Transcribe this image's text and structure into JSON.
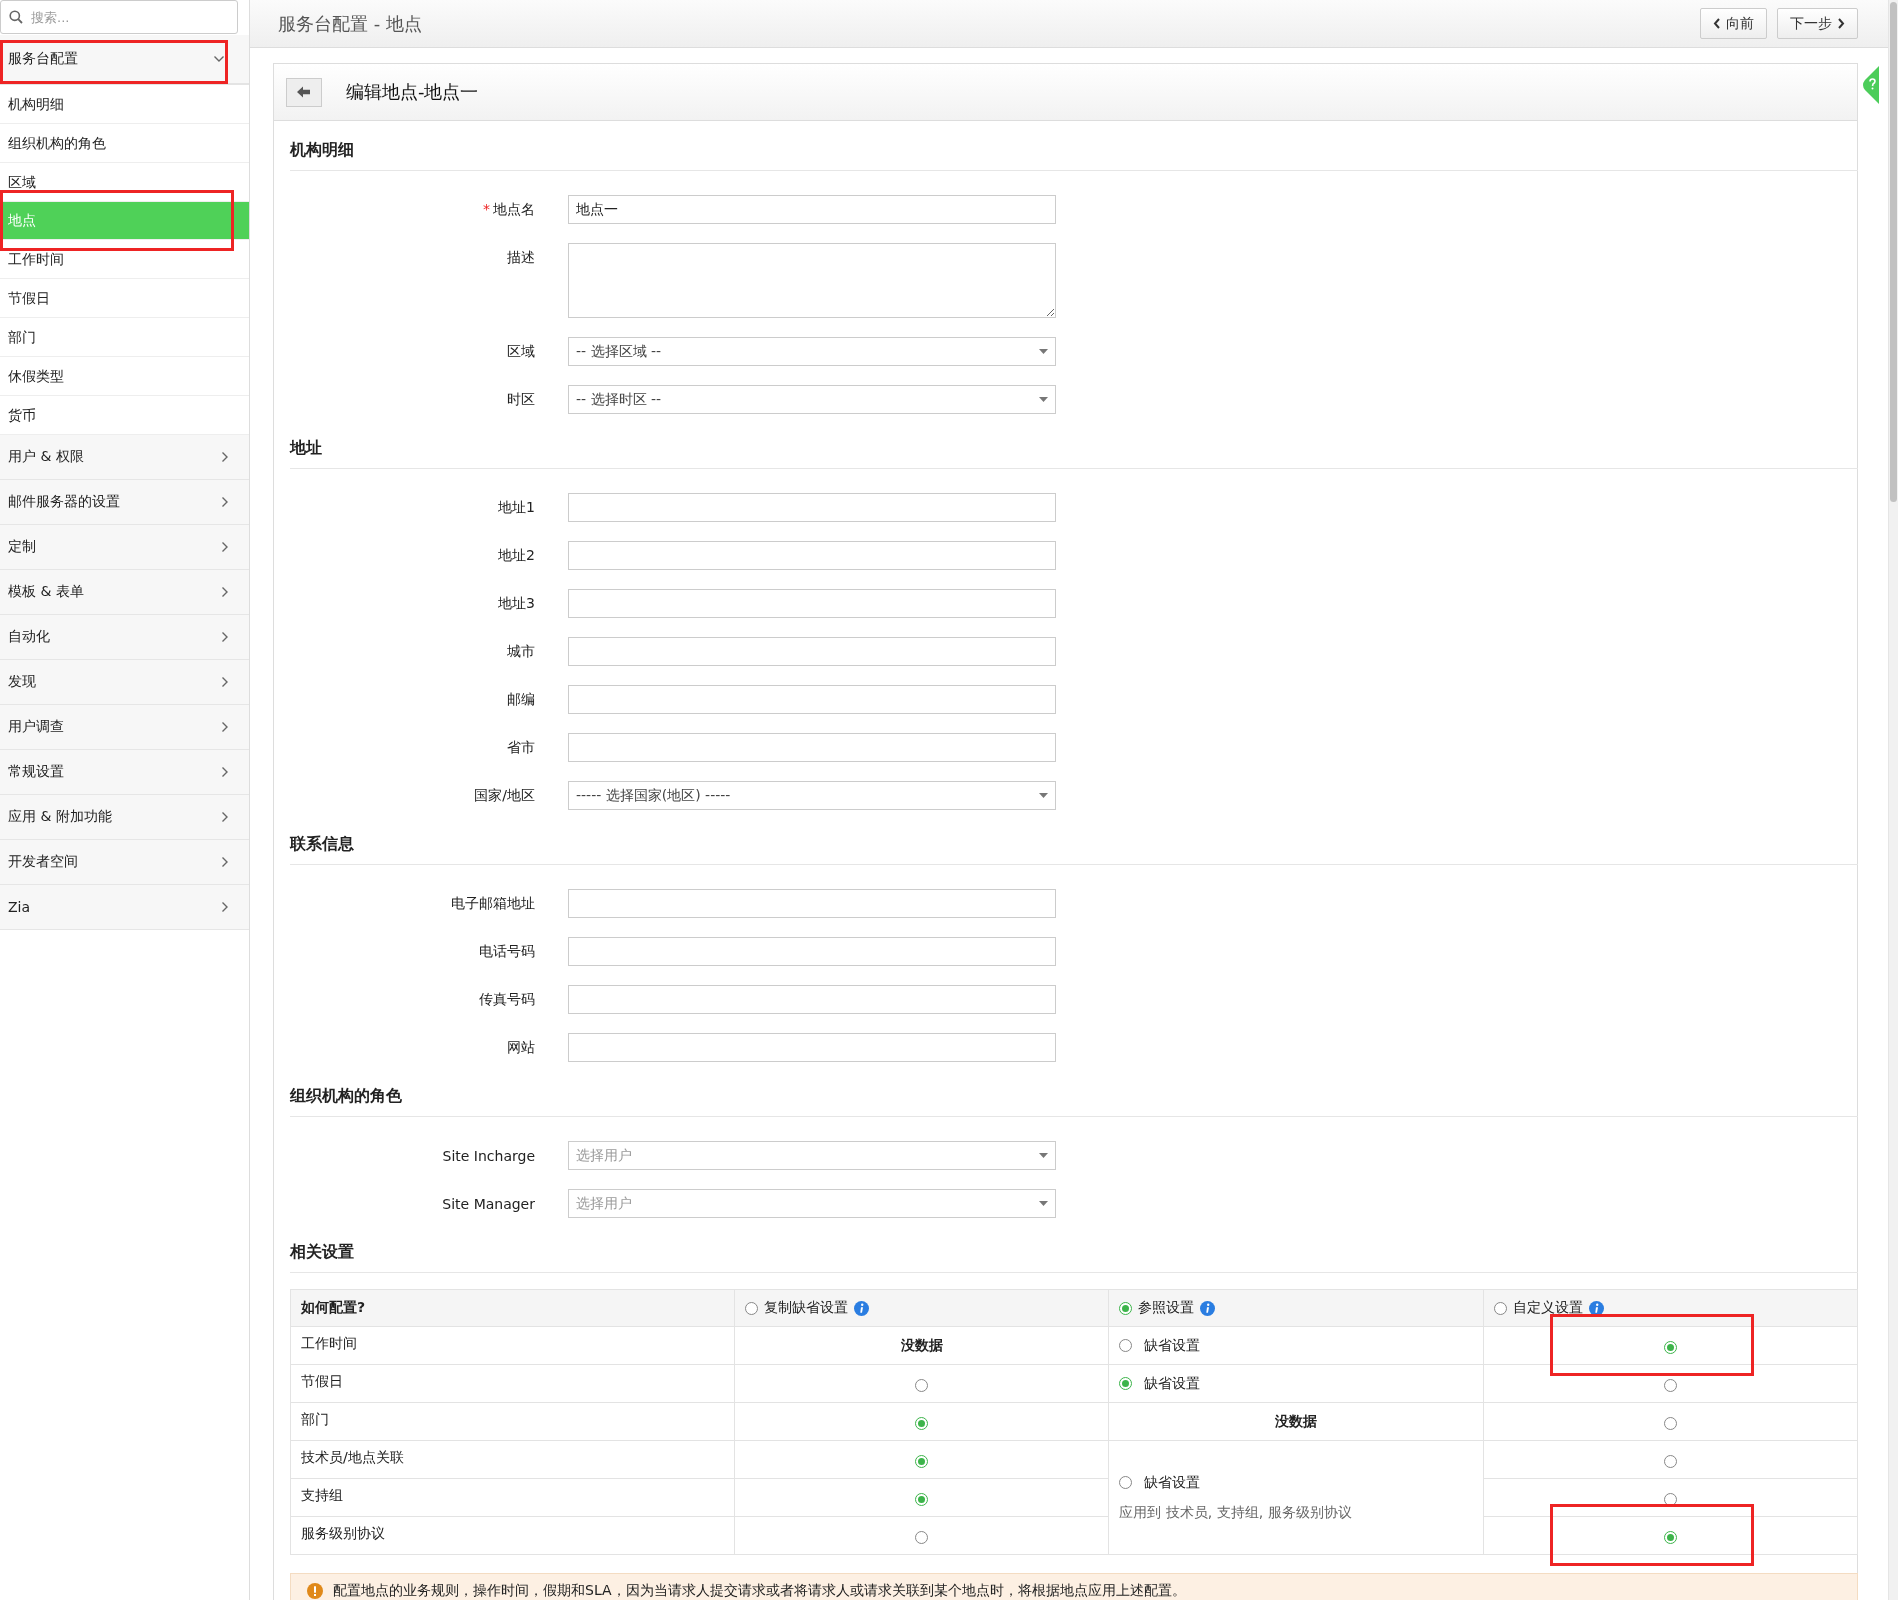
{
  "sidebar": {
    "search": {
      "placeholder": "搜索..."
    },
    "header": {
      "label": "服务台配置",
      "expanded": true,
      "highlighted": true
    },
    "items": [
      {
        "label": "机构明细",
        "selected": false,
        "highlighted": false
      },
      {
        "label": "组织机构的角色",
        "selected": false,
        "highlighted": false
      },
      {
        "label": "区域",
        "selected": false,
        "highlighted": false
      },
      {
        "label": "地点",
        "selected": true,
        "highlighted": true
      },
      {
        "label": "工作时间",
        "selected": false,
        "highlighted": false
      },
      {
        "label": "节假日",
        "selected": false,
        "highlighted": false
      },
      {
        "label": "部门",
        "selected": false,
        "highlighted": false
      },
      {
        "label": "休假类型",
        "selected": false,
        "highlighted": false
      },
      {
        "label": "货币",
        "selected": false,
        "highlighted": false
      }
    ],
    "groups": [
      {
        "label": "用户 & 权限"
      },
      {
        "label": "邮件服务器的设置"
      },
      {
        "label": "定制"
      },
      {
        "label": "模板 & 表单"
      },
      {
        "label": "自动化"
      },
      {
        "label": "发现"
      },
      {
        "label": "用户调查"
      },
      {
        "label": "常规设置"
      },
      {
        "label": "应用 & 附加功能"
      },
      {
        "label": "开发者空间"
      },
      {
        "label": "Zia"
      }
    ]
  },
  "top_bar": {
    "title": "服务台配置 - 地点",
    "buttons": [
      {
        "label": "向前",
        "kind": "prev"
      },
      {
        "label": "下一步",
        "kind": "next"
      }
    ]
  },
  "panel": {
    "title": "编辑地点-地点一",
    "sections": [
      {
        "title": "机构明细",
        "fields": [
          {
            "label": "地点名",
            "required_mark": "*",
            "kind": "text",
            "value": "地点一"
          },
          {
            "label": "描述",
            "kind": "textarea"
          },
          {
            "label": "区域",
            "kind": "select",
            "value": "-- 选择区域 --"
          },
          {
            "label": "时区",
            "kind": "select",
            "value": "-- 选择时区 --"
          }
        ]
      },
      {
        "title": "地址",
        "fields": [
          {
            "label": "地址1",
            "kind": "text"
          },
          {
            "label": "地址2",
            "kind": "text"
          },
          {
            "label": "地址3",
            "kind": "text"
          },
          {
            "label": "城市",
            "kind": "text"
          },
          {
            "label": "邮编",
            "kind": "text"
          },
          {
            "label": "省市",
            "kind": "text"
          },
          {
            "label": "国家/地区",
            "kind": "select",
            "value": "----- 选择国家(地区) -----"
          }
        ]
      },
      {
        "title": "联系信息",
        "fields": [
          {
            "label": "电子邮箱地址",
            "kind": "text"
          },
          {
            "label": "电话号码",
            "kind": "text"
          },
          {
            "label": "传真号码",
            "kind": "text"
          },
          {
            "label": "网站",
            "kind": "text"
          }
        ]
      },
      {
        "title": "组织机构的角色",
        "fields": [
          {
            "label": "Site Incharge",
            "kind": "select",
            "placeholder": "选择用户"
          },
          {
            "label": "Site Manager",
            "kind": "select",
            "placeholder": "选择用户"
          }
        ]
      }
    ],
    "related_settings": {
      "title": "相关设置",
      "columns": [
        {
          "label": "如何配置?",
          "kind": "plain"
        },
        {
          "label": "复制缺省设置",
          "kind": "option",
          "selected": false
        },
        {
          "label": "参照设置",
          "kind": "option",
          "selected": true
        },
        {
          "label": "自定义设置",
          "kind": "option",
          "selected": false
        }
      ],
      "rows": [
        {
          "cells": [
            {
              "kind": "label",
              "text": "工作时间"
            },
            {
              "kind": "text",
              "text": "没数据"
            },
            {
              "kind": "option",
              "label": "缺省设置",
              "selected": false
            },
            {
              "kind": "radio",
              "selected": true,
              "highlighted": true
            }
          ]
        },
        {
          "cells": [
            {
              "kind": "label",
              "text": "节假日"
            },
            {
              "kind": "radio",
              "selected": false,
              "highlighted": false
            },
            {
              "kind": "option",
              "label": "缺省设置",
              "selected": true
            },
            {
              "kind": "radio",
              "selected": false,
              "highlighted": false
            }
          ]
        },
        {
          "cells": [
            {
              "kind": "label",
              "text": "部门"
            },
            {
              "kind": "radio",
              "selected": true,
              "highlighted": false
            },
            {
              "kind": "text",
              "text": "没数据"
            },
            {
              "kind": "radio",
              "selected": false,
              "highlighted": false
            }
          ]
        },
        {
          "cells": [
            {
              "kind": "label",
              "text": "技术员/地点关联"
            },
            {
              "kind": "radio",
              "selected": true,
              "highlighted": false
            },
            {
              "kind": "option",
              "label": "缺省设置",
              "selected": false,
              "rowspan": 3,
              "note": "应用到 技术员, 支持组, 服务级别协议"
            },
            {
              "kind": "radio",
              "selected": false,
              "highlighted": false
            }
          ]
        },
        {
          "cells": [
            {
              "kind": "label",
              "text": "支持组"
            },
            {
              "kind": "radio",
              "selected": true,
              "highlighted": false
            },
            {
              "kind": "radio",
              "selected": false,
              "highlighted": false
            }
          ]
        },
        {
          "cells": [
            {
              "kind": "label",
              "text": "服务级别协议"
            },
            {
              "kind": "radio",
              "selected": false,
              "highlighted": false
            },
            {
              "kind": "radio",
              "selected": true,
              "highlighted": true
            }
          ]
        }
      ],
      "notice": "配置地点的业务规则，操作时间，假期和SLA，因为当请求人提交请求或者将请求人或请求关联到某个地点时，将根据地点应用上述配置。"
    }
  }
}
